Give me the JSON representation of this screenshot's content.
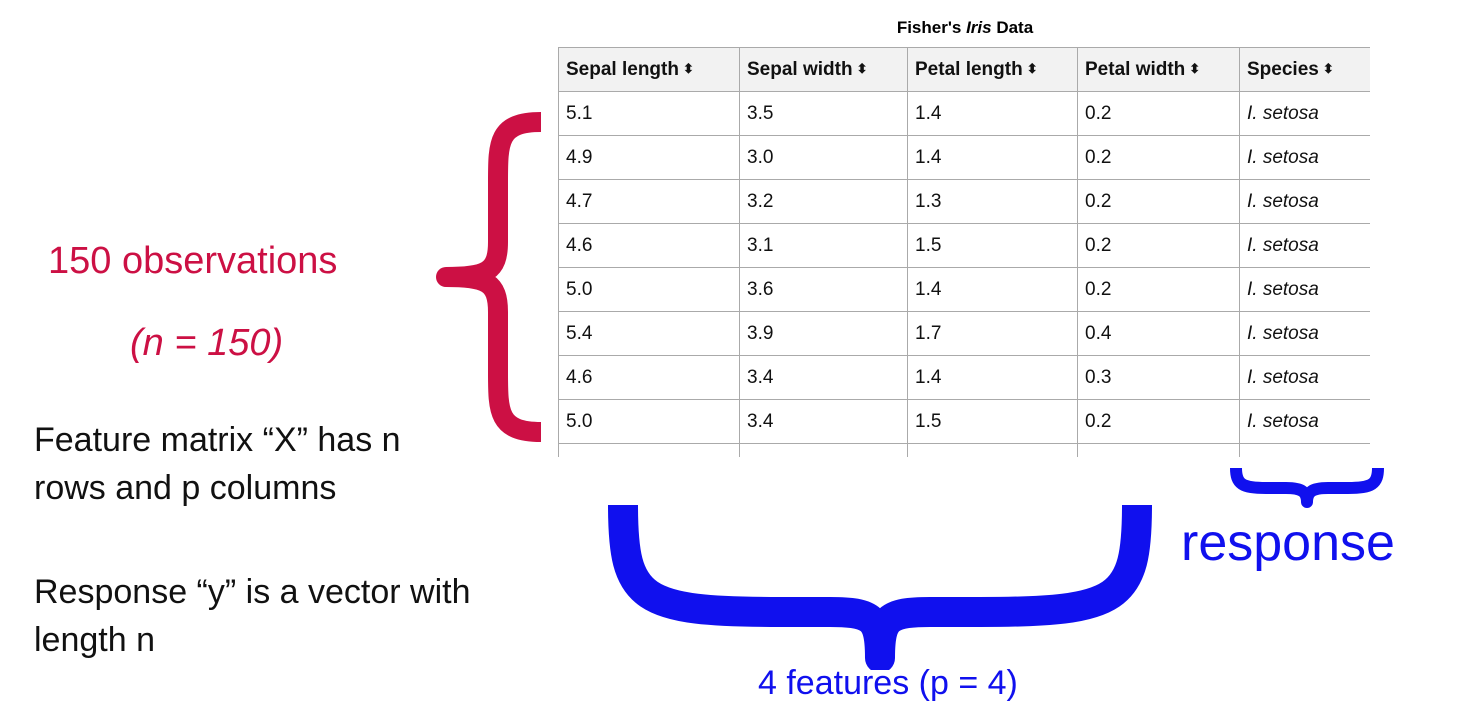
{
  "table": {
    "title_prefix": "Fisher's ",
    "title_italic": "Iris",
    "title_suffix": " Data",
    "sort_icon": "⬍",
    "headers": [
      "Sepal length",
      "Sepal width",
      "Petal length",
      "Petal width",
      "Species"
    ],
    "rows": [
      [
        "5.1",
        "3.5",
        "1.4",
        "0.2",
        "I. setosa"
      ],
      [
        "4.9",
        "3.0",
        "1.4",
        "0.2",
        "I. setosa"
      ],
      [
        "4.7",
        "3.2",
        "1.3",
        "0.2",
        "I. setosa"
      ],
      [
        "4.6",
        "3.1",
        "1.5",
        "0.2",
        "I. setosa"
      ],
      [
        "5.0",
        "3.6",
        "1.4",
        "0.2",
        "I. setosa"
      ],
      [
        "5.4",
        "3.9",
        "1.7",
        "0.4",
        "I. setosa"
      ],
      [
        "4.6",
        "3.4",
        "1.4",
        "0.3",
        "I. setosa"
      ],
      [
        "5.0",
        "3.4",
        "1.5",
        "0.2",
        "I. setosa"
      ]
    ]
  },
  "annotations": {
    "observations": "150 observations",
    "n_equals": "(n = 150)",
    "feature_matrix": "Feature matrix “X” has n rows and p columns",
    "response_vector": "Response “y” is a vector with length n",
    "features": "4 features (p = 4)",
    "response": "response"
  },
  "colors": {
    "red": "#cc1044",
    "blue": "#1010ee",
    "header_bg": "#f2f2f2",
    "border": "#aaaaaa"
  }
}
